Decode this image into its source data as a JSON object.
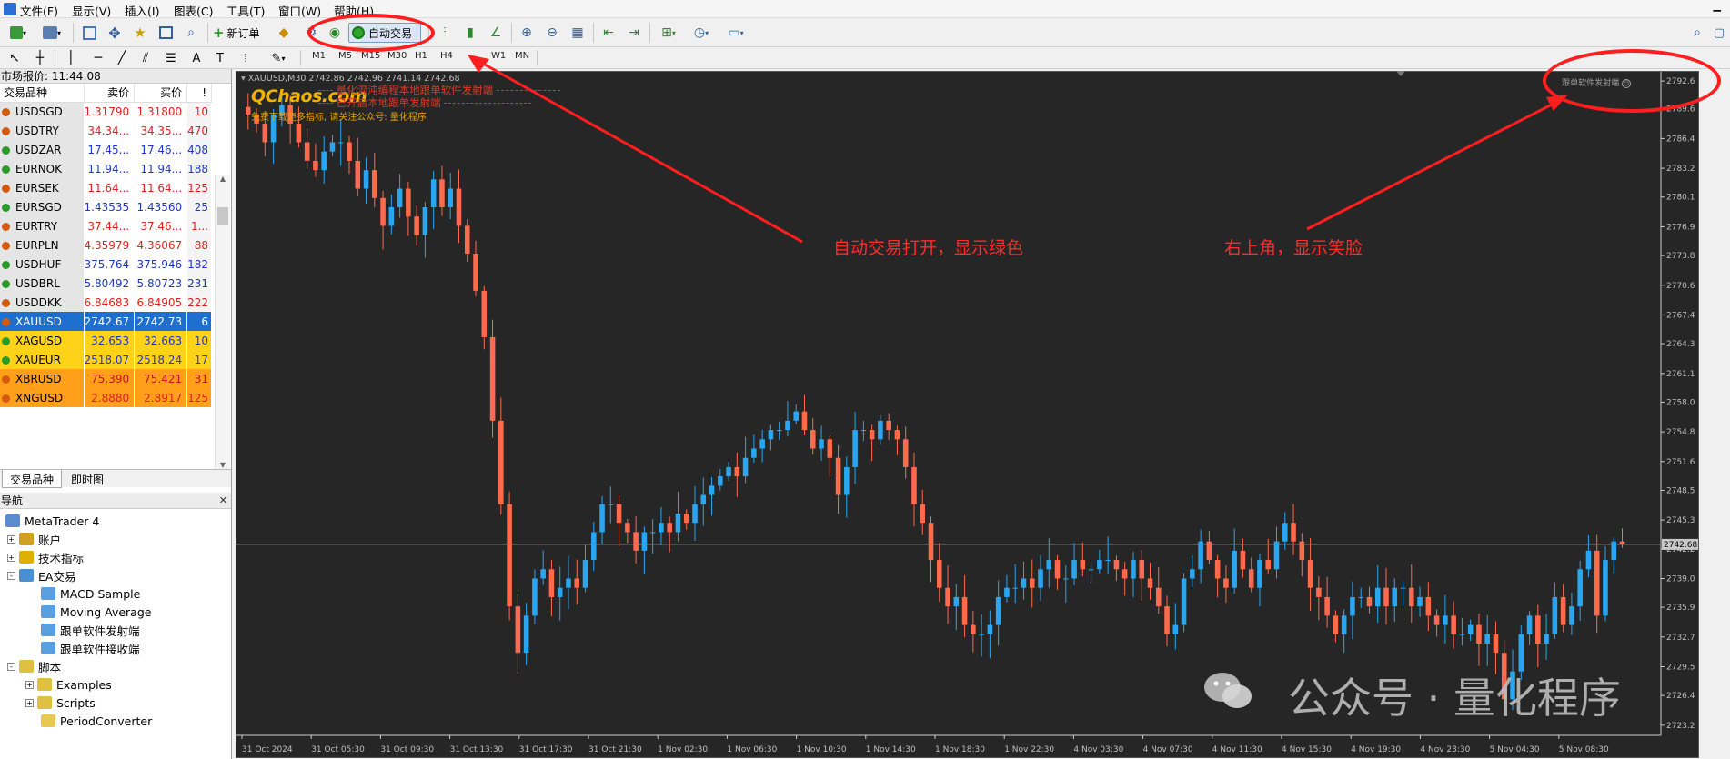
{
  "menu": [
    "文件(F)",
    "显示(V)",
    "插入(I)",
    "图表(C)",
    "工具(T)",
    "窗口(W)",
    "帮助(H)"
  ],
  "toolbar": {
    "new_order_label": "新订单",
    "auto_trading_label": "自动交易"
  },
  "timeframes": [
    "M1",
    "M5",
    "M15",
    "M30",
    "H1",
    "H4",
    "D1",
    "W1",
    "MN"
  ],
  "market_watch": {
    "title": "市场报价: 11:44:08",
    "columns": [
      "交易品种",
      "卖价",
      "买价",
      "!"
    ],
    "rows": [
      {
        "symbol": "USDSGD",
        "bid": "1.31790",
        "ask": "1.31800",
        "spread": "10",
        "dir": "down"
      },
      {
        "symbol": "USDTRY",
        "bid": "34.34...",
        "ask": "34.35...",
        "spread": "470",
        "dir": "down"
      },
      {
        "symbol": "USDZAR",
        "bid": "17.45...",
        "ask": "17.46...",
        "spread": "408",
        "dir": "up"
      },
      {
        "symbol": "EURNOK",
        "bid": "11.94...",
        "ask": "11.94...",
        "spread": "188",
        "dir": "up"
      },
      {
        "symbol": "EURSEK",
        "bid": "11.64...",
        "ask": "11.64...",
        "spread": "125",
        "dir": "down"
      },
      {
        "symbol": "EURSGD",
        "bid": "1.43535",
        "ask": "1.43560",
        "spread": "25",
        "dir": "up"
      },
      {
        "symbol": "EURTRY",
        "bid": "37.44...",
        "ask": "37.46...",
        "spread": "1...",
        "dir": "down"
      },
      {
        "symbol": "EURPLN",
        "bid": "4.35979",
        "ask": "4.36067",
        "spread": "88",
        "dir": "down"
      },
      {
        "symbol": "USDHUF",
        "bid": "375.764",
        "ask": "375.946",
        "spread": "182",
        "dir": "up"
      },
      {
        "symbol": "USDBRL",
        "bid": "5.80492",
        "ask": "5.80723",
        "spread": "231",
        "dir": "up"
      },
      {
        "symbol": "USDDKK",
        "bid": "6.84683",
        "ask": "6.84905",
        "spread": "222",
        "dir": "down"
      },
      {
        "symbol": "XAUUSD",
        "bid": "2742.67",
        "ask": "2742.73",
        "spread": "6",
        "dir": "down",
        "hl": "selected"
      },
      {
        "symbol": "XAGUSD",
        "bid": "32.653",
        "ask": "32.663",
        "spread": "10",
        "dir": "up",
        "hl": "yellow"
      },
      {
        "symbol": "XAUEUR",
        "bid": "2518.07",
        "ask": "2518.24",
        "spread": "17",
        "dir": "up",
        "hl": "yellow"
      },
      {
        "symbol": "XBRUSD",
        "bid": "75.390",
        "ask": "75.421",
        "spread": "31",
        "dir": "down",
        "hl": "orange"
      },
      {
        "symbol": "XNGUSD",
        "bid": "2.8880",
        "ask": "2.8917",
        "spread": "125",
        "dir": "down",
        "hl": "cut"
      }
    ],
    "tabs": [
      "交易品种",
      "即时图"
    ]
  },
  "navigator": {
    "title": "导航",
    "items": [
      {
        "label": "MetaTrader 4",
        "level": 0,
        "exp": "",
        "icon": "terminal-icon"
      },
      {
        "label": "账户",
        "level": 1,
        "exp": "+",
        "icon": "accounts-icon"
      },
      {
        "label": "技术指标",
        "level": 1,
        "exp": "+",
        "icon": "indicators-icon"
      },
      {
        "label": "EA交易",
        "level": 1,
        "exp": "-",
        "icon": "expert-advisors-icon"
      },
      {
        "label": "MACD Sample",
        "level": 2,
        "exp": "",
        "icon": "ea-icon"
      },
      {
        "label": "Moving Average",
        "level": 2,
        "exp": "",
        "icon": "ea-icon"
      },
      {
        "label": "跟单软件发射端",
        "level": 2,
        "exp": "",
        "icon": "ea-icon"
      },
      {
        "label": "跟单软件接收端",
        "level": 2,
        "exp": "",
        "icon": "ea-icon"
      },
      {
        "label": "脚本",
        "level": 1,
        "exp": "-",
        "icon": "scripts-icon"
      },
      {
        "label": "Examples",
        "level": 2,
        "exp": "+",
        "icon": "script-folder-icon"
      },
      {
        "label": "Scripts",
        "level": 2,
        "exp": "+",
        "icon": "script-folder-icon"
      },
      {
        "label": "PeriodConverter",
        "level": 2,
        "exp": "",
        "icon": "script-icon"
      }
    ]
  },
  "chart": {
    "header": "XAUUSD,M30  2742.86 2742.96 2741.14 2742.68",
    "logo": "QChaos.com",
    "line1": "量化混沌编程本地跟单软件发射端",
    "line2": "已开启本地跟单发射端",
    "line3": "免费下载更多指标, 请关注公众号: 量化程序",
    "ea_label": "跟单软件发射端",
    "current_price": "2742.68"
  },
  "annotations": {
    "left": "自动交易打开，显示绿色",
    "right": "右上角，显示笑脸"
  },
  "watermark": "公众号 · 量化程序",
  "colors": {
    "bull": "#2aa6f0",
    "bear": "#ff6a4d",
    "bg": "#262626",
    "annot": "#ff2a2a"
  },
  "chart_data": {
    "type": "candlestick",
    "symbol": "XAUUSD",
    "timeframe": "M30",
    "ylim": [
      2722.5,
      2793.0
    ],
    "y_ticks": [
      "2792.6",
      "2789.6",
      "2786.4",
      "2783.2",
      "2780.1",
      "2776.9",
      "2773.8",
      "2770.6",
      "2767.4",
      "2764.3",
      "2761.1",
      "2758.0",
      "2754.8",
      "2751.6",
      "2748.5",
      "2745.3",
      "2742.2",
      "2739.0",
      "2735.9",
      "2732.7",
      "2729.5",
      "2726.4",
      "2723.2"
    ],
    "x_ticks": [
      "31 Oct 2024",
      "31 Oct 05:30",
      "31 Oct 09:30",
      "31 Oct 13:30",
      "31 Oct 17:30",
      "31 Oct 21:30",
      "1 Nov 02:30",
      "1 Nov 06:30",
      "1 Nov 10:30",
      "1 Nov 14:30",
      "1 Nov 18:30",
      "1 Nov 22:30",
      "4 Nov 03:30",
      "4 Nov 07:30",
      "4 Nov 11:30",
      "4 Nov 15:30",
      "4 Nov 19:30",
      "4 Nov 23:30",
      "5 Nov 04:30",
      "5 Nov 08:30"
    ],
    "close": [
      2789,
      2788,
      2786,
      2789,
      2790,
      2788,
      2786,
      2784,
      2783,
      2785,
      2786,
      2786,
      2784,
      2781,
      2783,
      2780,
      2777,
      2779,
      2781,
      2778,
      2776,
      2779,
      2782,
      2779,
      2781,
      2777,
      2774,
      2770,
      2765,
      2756,
      2747,
      2736,
      2731,
      2735,
      2739,
      2740,
      2737,
      2738,
      2739,
      2738,
      2741,
      2744,
      2747,
      2747,
      2745,
      2744,
      2742,
      2744,
      2744,
      2745,
      2744,
      2746,
      2745,
      2747,
      2748,
      2749,
      2750,
      2751,
      2750,
      2752,
      2753,
      2754,
      2755,
      2755,
      2756,
      2757,
      2755,
      2753,
      2754,
      2752,
      2748,
      2751,
      2755,
      2755,
      2754,
      2756,
      2755,
      2754,
      2751,
      2747,
      2745,
      2741,
      2738,
      2736,
      2737,
      2734,
      2733,
      2733,
      2734,
      2737,
      2738,
      2738,
      2739,
      2738,
      2740,
      2741,
      2739,
      2739,
      2741,
      2740,
      2740,
      2741,
      2741,
      2740,
      2739,
      2741,
      2739,
      2738,
      2736,
      2733,
      2734,
      2739,
      2740,
      2743,
      2741,
      2739,
      2738,
      2742,
      2740,
      2738,
      2741,
      2740,
      2743,
      2745,
      2743,
      2741,
      2738,
      2737,
      2735,
      2733,
      2735,
      2737,
      2737,
      2736,
      2738,
      2736,
      2738,
      2738,
      2736,
      2737,
      2735,
      2734,
      2735,
      2733,
      2733,
      2734,
      2732,
      2733,
      2731,
      2726,
      2729,
      2733,
      2735,
      2732,
      2733,
      2737,
      2734,
      2736,
      2740,
      2742,
      2735,
      2741,
      2743,
      2742.7
    ]
  }
}
